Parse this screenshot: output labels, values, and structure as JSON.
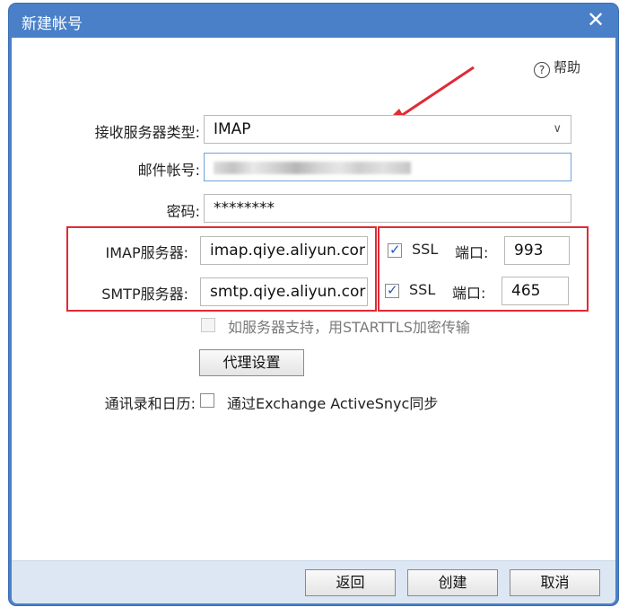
{
  "window": {
    "title": "新建帐号",
    "close_glyph": "✕"
  },
  "help": {
    "label": "帮助",
    "icon": "question-circle-icon"
  },
  "form": {
    "receive_type_label": "接收服务器类型:",
    "receive_type_value": "IMAP",
    "email_label": "邮件帐号:",
    "password_label": "密码:",
    "password_value": "********",
    "imap_label": "IMAP服务器:",
    "imap_value": "imap.qiye.aliyun.cor",
    "smtp_label": "SMTP服务器:",
    "smtp_value": "smtp.qiye.aliyun.cor",
    "ssl_label": "SSL",
    "port_label": "端口:",
    "imap_ssl_checked": true,
    "smtp_ssl_checked": true,
    "imap_port": "993",
    "smtp_port": "465",
    "starttls_label": "如服务器支持，用STARTTLS加密传输",
    "proxy_button": "代理设置",
    "contacts_label": "通讯录和日历:",
    "exchange_label": "通过Exchange ActiveSnyc同步"
  },
  "footer": {
    "back": "返回",
    "create": "创建",
    "cancel": "取消"
  },
  "annotation": {
    "color": "#e02a35"
  }
}
